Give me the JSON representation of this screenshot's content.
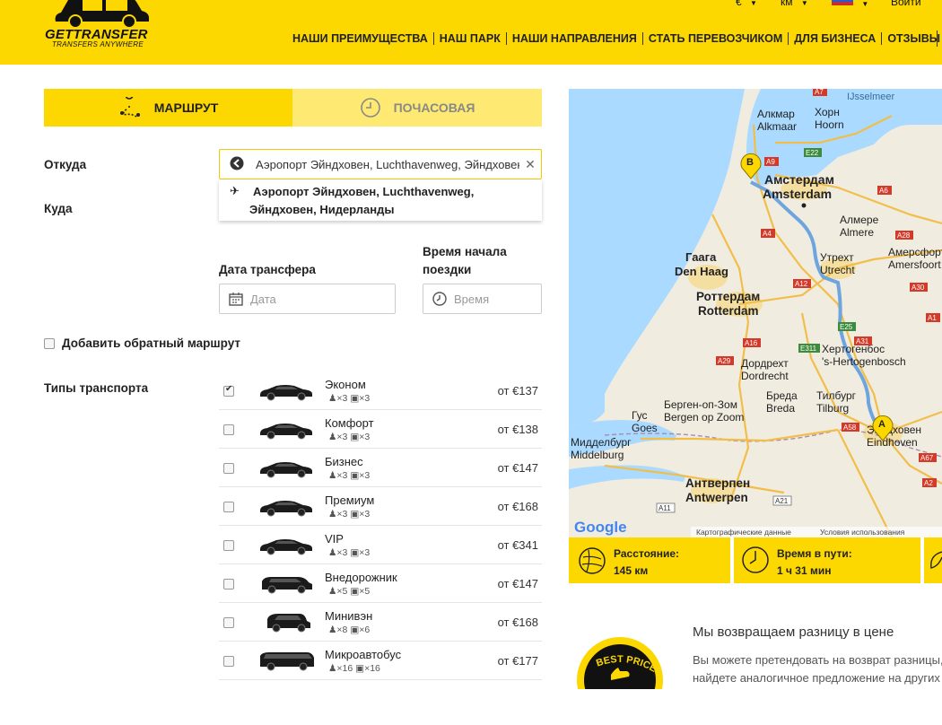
{
  "header": {
    "logo_text": "GETTRANSFER",
    "logo_sub": "TRANSFERS ANYWHERE",
    "currency": "€",
    "units": "км",
    "login": "Войти",
    "nav": [
      "НАШИ ПРЕИМУЩЕСТВА",
      "НАШ ПАРК",
      "НАШИ НАПРАВЛЕНИЯ",
      "СТАТЬ ПЕРЕВОЗЧИКОМ",
      "ДЛЯ БИЗНЕСА",
      "ОТЗЫВЫ"
    ]
  },
  "tabs": {
    "route": "МАРШРУТ",
    "hourly": "ПОЧАСОВАЯ"
  },
  "form": {
    "from_label": "Откуда",
    "to_label": "Куда",
    "from_value": "Аэропорт Эйндховен, Luchthavenweg, Эйндховен, Нидерланды",
    "suggestion_line1": "Аэропорт Эйндховен, Luchthavenweg,",
    "suggestion_line2": "Эйндховен, Нидерланды",
    "date_label": "Дата трансфера",
    "date_placeholder": "Дата",
    "time_label_1": "Время начала",
    "time_label_2": "поездки",
    "time_placeholder": "Время",
    "return_label": "Добавить обратный маршрут",
    "types_label": "Типы транспорта"
  },
  "vehicles": [
    {
      "name": "Эконом",
      "pax": "×3",
      "bags": "×3",
      "price": "от €137",
      "checked": true
    },
    {
      "name": "Комфорт",
      "pax": "×3",
      "bags": "×3",
      "price": "от €138",
      "checked": false
    },
    {
      "name": "Бизнес",
      "pax": "×3",
      "bags": "×3",
      "price": "от €147",
      "checked": false
    },
    {
      "name": "Премиум",
      "pax": "×3",
      "bags": "×3",
      "price": "от €168",
      "checked": false
    },
    {
      "name": "VIP",
      "pax": "×3",
      "bags": "×3",
      "price": "от €341",
      "checked": false
    },
    {
      "name": "Внедорожник",
      "pax": "×5",
      "bags": "×5",
      "price": "от €147",
      "checked": false
    },
    {
      "name": "Минивэн",
      "pax": "×8",
      "bags": "×6",
      "price": "от €168",
      "checked": false
    },
    {
      "name": "Микроавтобус",
      "pax": "×16",
      "bags": "×16",
      "price": "от €177",
      "checked": false
    }
  ],
  "map": {
    "cities": [
      {
        "ru": "Амстердам",
        "en": "Amsterdam"
      },
      {
        "ru": "Гаага",
        "en": "Den Haag"
      },
      {
        "ru": "Роттердам",
        "en": "Rotterdam"
      },
      {
        "ru": "Утрехт",
        "en": "Utrecht"
      },
      {
        "ru": "Хертогенбос",
        "en": "'s-Hertogenbosch"
      },
      {
        "ru": "Бреда",
        "en": "Breda"
      },
      {
        "ru": "Тилбург",
        "en": "Tilburg"
      },
      {
        "ru": "Антверпен",
        "en": "Antwerpen"
      },
      {
        "ru": "Дордрехт",
        "en": "Dordrecht"
      },
      {
        "ru": "Берген-оп-Зом",
        "en": "Bergen op Zoom"
      },
      {
        "ru": "Алкмар",
        "en": "Alkmaar"
      },
      {
        "ru": "Хорн",
        "en": "Hoorn"
      },
      {
        "ru": "Алмере",
        "en": "Almere"
      },
      {
        "ru": "Амерсфорт",
        "en": "Amersfoort"
      },
      {
        "ru": "Гус",
        "en": "Goes"
      },
      {
        "ru": "Мидделбург",
        "en": "Middelburg"
      },
      {
        "ru": "Эйндховен",
        "en": "Eindhoven"
      }
    ],
    "water_label": "IJsselmeer",
    "roads": [
      "A7",
      "A9",
      "E22",
      "A6",
      "A4",
      "A28",
      "A12",
      "A30",
      "E25",
      "A31",
      "A16",
      "E311",
      "A29",
      "A58",
      "A21",
      "A11",
      "A2",
      "A67",
      "A1"
    ],
    "marker_a": "A",
    "marker_b": "B",
    "google": "Google",
    "attribution": "Картографические данные",
    "terms": "Условия использования"
  },
  "stats": {
    "distance_label": "Расстояние:",
    "distance_value": "145 км",
    "time_label": "Время в пути:",
    "time_value": "1 ч 31 мин"
  },
  "promo": {
    "badge": "BEST PRICE",
    "title": "Мы возвращаем разницу в цене",
    "text_line1": "Вы можете претендовать на возврат разницы,",
    "text_line2": "найдете аналогичное предложение на других"
  },
  "colors": {
    "brand_yellow": "#fdd800",
    "route_blue": "#6fa5df"
  }
}
